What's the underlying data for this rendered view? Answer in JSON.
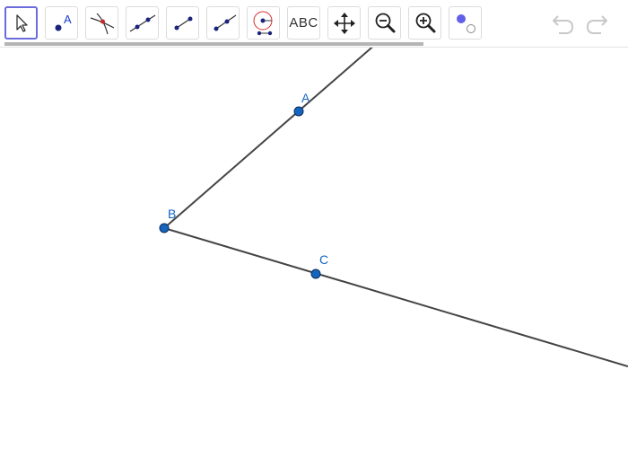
{
  "toolbar": {
    "tools": [
      {
        "name": "move-tool",
        "label": ""
      },
      {
        "name": "point-tool",
        "label": "A"
      },
      {
        "name": "intersect-tool",
        "label": ""
      },
      {
        "name": "line-tool",
        "label": ""
      },
      {
        "name": "segment-tool",
        "label": ""
      },
      {
        "name": "ray-tool",
        "label": ""
      },
      {
        "name": "circle-tool",
        "label": ""
      },
      {
        "name": "text-tool",
        "label": "ABC"
      },
      {
        "name": "move-graphics-view-tool",
        "label": ""
      },
      {
        "name": "zoom-out-tool",
        "label": ""
      },
      {
        "name": "zoom-in-tool",
        "label": ""
      },
      {
        "name": "style-tool",
        "label": ""
      }
    ],
    "selected_tool": "move-tool",
    "icons": {
      "undo": "undo-icon",
      "redo": "redo-icon"
    }
  },
  "construction": {
    "points": [
      {
        "label": "A"
      },
      {
        "label": "B"
      },
      {
        "label": "C"
      }
    ]
  },
  "colors": {
    "point_fill": "#1565c0",
    "label": "#1565c0",
    "line": "#444444",
    "selected_border": "#6b6bde",
    "icon_dark": "#1a237e",
    "disabled_icon": "#c8c8c8"
  }
}
